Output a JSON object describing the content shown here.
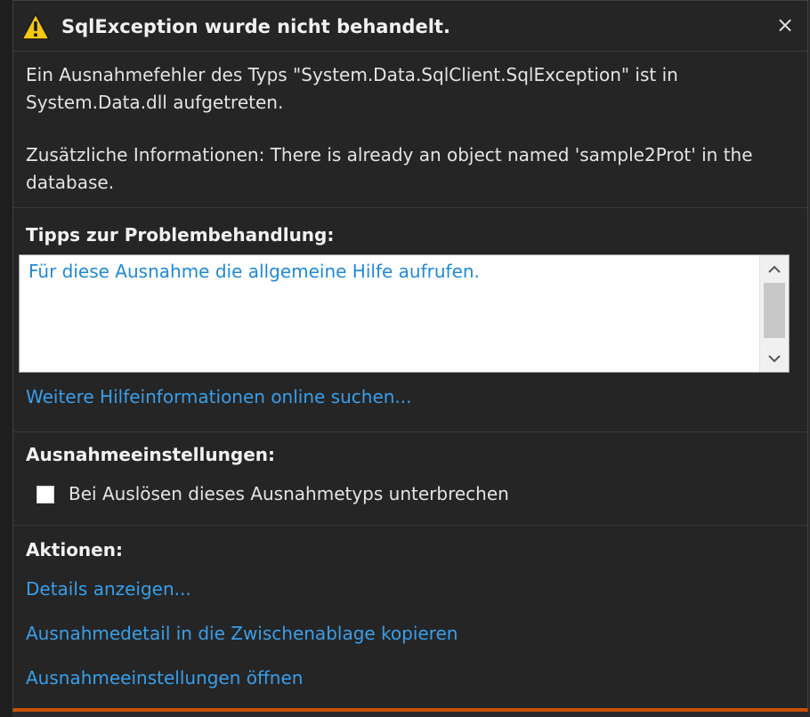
{
  "dialog": {
    "title": "SqlException wurde nicht behandelt.",
    "close_label": "×",
    "message_line1": "Ein Ausnahmefehler des Typs \"System.Data.SqlClient.SqlException\" ist in",
    "message_line2": "System.Data.dll aufgetreten.",
    "info_line1": "Zusätzliche Informationen: There is already an object named 'sample2Prot' in the",
    "info_line2": "database."
  },
  "tips": {
    "heading": "Tipps zur Problembehandlung:",
    "items": [
      {
        "label": "Für diese Ausnahme die allgemeine Hilfe aufrufen."
      }
    ],
    "more_help_link": "Weitere Hilfeinformationen online suchen..."
  },
  "settings": {
    "heading": "Ausnahmeeinstellungen:",
    "checkbox_label": "Bei Auslösen dieses Ausnahmetyps unterbrechen",
    "checked": false
  },
  "actions": {
    "heading": "Aktionen:",
    "links": [
      {
        "label": "Details anzeigen..."
      },
      {
        "label": "Ausnahmedetail in die Zwischenablage kopieren"
      },
      {
        "label": "Ausnahmeeinstellungen öffnen"
      }
    ]
  },
  "colors": {
    "background": "#252526",
    "link": "#3a9ee8",
    "warning": "#f2c811",
    "accent_border": "#ca5100"
  },
  "icons": {
    "warning": "warning-icon",
    "close": "close-icon",
    "scroll_up": "chevron-up-icon",
    "scroll_down": "chevron-down-icon"
  }
}
